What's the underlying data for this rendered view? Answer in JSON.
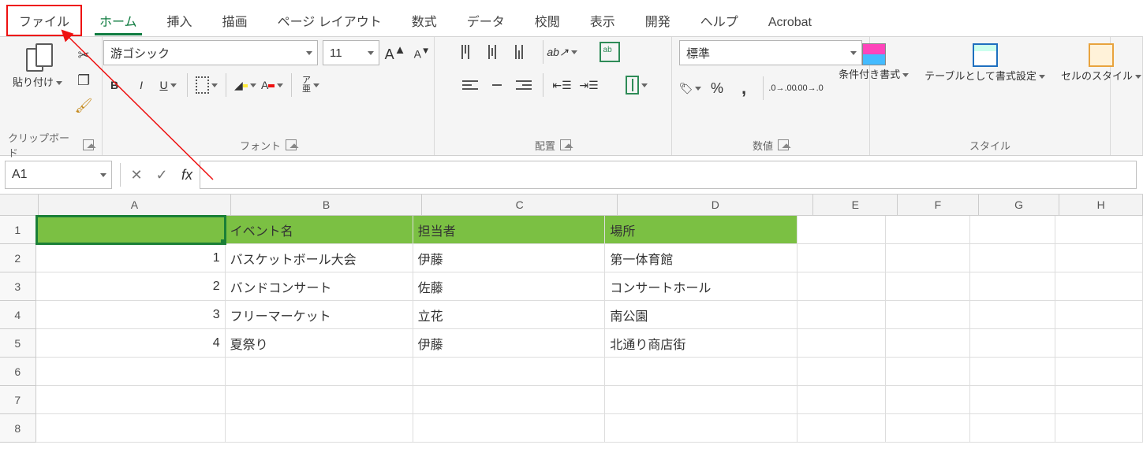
{
  "menu": {
    "file": "ファイル",
    "home": "ホーム",
    "insert": "挿入",
    "draw": "描画",
    "pagelayout": "ページ レイアウト",
    "formulas": "数式",
    "data": "データ",
    "review": "校閲",
    "view": "表示",
    "developer": "開発",
    "help": "ヘルプ",
    "acrobat": "Acrobat"
  },
  "ribbon": {
    "clipboard": {
      "label": "クリップボード",
      "paste": "貼り付け"
    },
    "font": {
      "label": "フォント",
      "name": "游ゴシック",
      "size": "11"
    },
    "alignment": {
      "label": "配置"
    },
    "number": {
      "label": "数値",
      "format": "標準"
    },
    "styles": {
      "label": "スタイル",
      "cond": "条件付き書式",
      "table": "テーブルとして書式設定",
      "cell": "セルのスタイル"
    }
  },
  "formula": {
    "namebox": "A1",
    "value": ""
  },
  "cols": [
    "A",
    "B",
    "C",
    "D",
    "E",
    "F",
    "G",
    "H"
  ],
  "rownums": [
    "1",
    "2",
    "3",
    "4",
    "5",
    "6",
    "7",
    "8"
  ],
  "sheet": {
    "header": {
      "b": "イベント名",
      "c": "担当者",
      "d": "場所"
    },
    "rows": [
      {
        "a": "1",
        "b": "バスケットボール大会",
        "c": "伊藤",
        "d": "第一体育館"
      },
      {
        "a": "2",
        "b": "バンドコンサート",
        "c": "佐藤",
        "d": "コンサートホール"
      },
      {
        "a": "3",
        "b": "フリーマーケット",
        "c": "立花",
        "d": "南公園"
      },
      {
        "a": "4",
        "b": "夏祭り",
        "c": "伊藤",
        "d": "北通り商店街"
      }
    ]
  }
}
